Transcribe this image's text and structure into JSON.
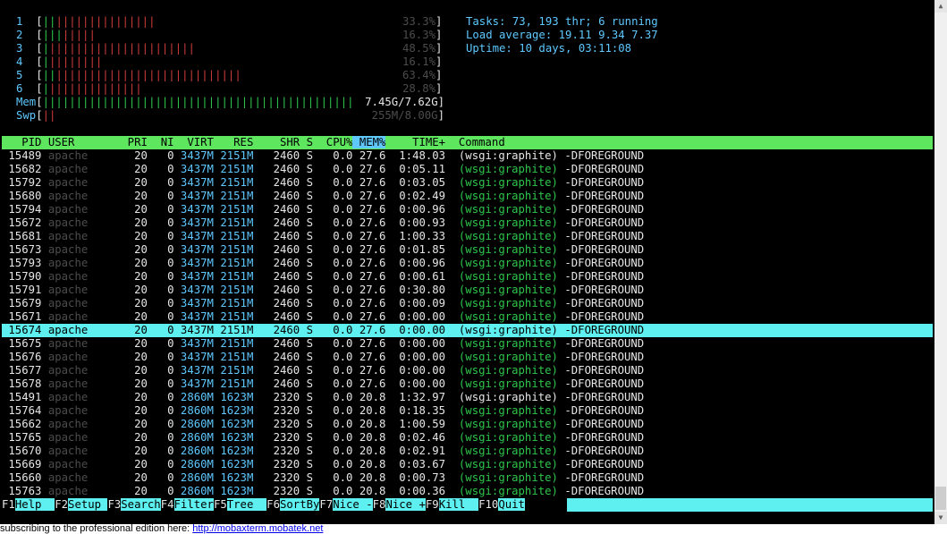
{
  "meters": {
    "cpus": [
      {
        "num": "1",
        "normal": "||",
        "kernel": "|||||||||||||||",
        "pct": "33.3%"
      },
      {
        "num": "2",
        "normal": "|||",
        "kernel": "|||||",
        "pct": "16.3%"
      },
      {
        "num": "3",
        "normal": "|",
        "kernel": "||||||||||||||||||||||",
        "pct": "48.5%"
      },
      {
        "num": "4",
        "normal": "|",
        "kernel": "||||||||",
        "pct": "16.1%"
      },
      {
        "num": "5",
        "normal": "||",
        "kernel": "||||||||||||||||||||||||||||",
        "pct": "63.4%"
      },
      {
        "num": "6",
        "normal": "|",
        "kernel": "||||||||||||||",
        "pct": "28.8%"
      }
    ],
    "mem": {
      "label": "Mem",
      "bars": "|||||||||||||||||||||||||||||||||||||||||||||||",
      "value": "7.45G/7.62G"
    },
    "swp": {
      "label": "Swp",
      "bars": "||",
      "value": "255M/8.00G"
    }
  },
  "summary": {
    "tasks": "Tasks: 73, 193 thr; 6 running",
    "load": "Load average: 19.11 9.34 7.37",
    "uptime": "Uptime: 10 days, 03:11:08"
  },
  "columns": [
    "PID",
    "USER",
    "PRI",
    "NI",
    "VIRT",
    "RES",
    "SHR",
    "S",
    "CPU%",
    "MEM%",
    "TIME+",
    "Command"
  ],
  "sorted_column": "MEM%",
  "processes": [
    {
      "pid": "15489",
      "user": "apache",
      "pri": "20",
      "ni": "0",
      "virt": "3437M",
      "res": "2151M",
      "shr": "2460",
      "s": "S",
      "cpu": "0.0",
      "mem": "27.6",
      "time": "1:48.03",
      "cmd": "(wsgi:graphite)",
      "args": "-DFOREGROUND",
      "main": true
    },
    {
      "pid": "15682",
      "user": "apache",
      "pri": "20",
      "ni": "0",
      "virt": "3437M",
      "res": "2151M",
      "shr": "2460",
      "s": "S",
      "cpu": "0.0",
      "mem": "27.6",
      "time": "0:05.11",
      "cmd": "(wsgi:graphite)",
      "args": "-DFOREGROUND",
      "main": false
    },
    {
      "pid": "15792",
      "user": "apache",
      "pri": "20",
      "ni": "0",
      "virt": "3437M",
      "res": "2151M",
      "shr": "2460",
      "s": "S",
      "cpu": "0.0",
      "mem": "27.6",
      "time": "0:03.05",
      "cmd": "(wsgi:graphite)",
      "args": "-DFOREGROUND",
      "main": false
    },
    {
      "pid": "15680",
      "user": "apache",
      "pri": "20",
      "ni": "0",
      "virt": "3437M",
      "res": "2151M",
      "shr": "2460",
      "s": "S",
      "cpu": "0.0",
      "mem": "27.6",
      "time": "0:02.49",
      "cmd": "(wsgi:graphite)",
      "args": "-DFOREGROUND",
      "main": false
    },
    {
      "pid": "15794",
      "user": "apache",
      "pri": "20",
      "ni": "0",
      "virt": "3437M",
      "res": "2151M",
      "shr": "2460",
      "s": "S",
      "cpu": "0.0",
      "mem": "27.6",
      "time": "0:00.96",
      "cmd": "(wsgi:graphite)",
      "args": "-DFOREGROUND",
      "main": false
    },
    {
      "pid": "15672",
      "user": "apache",
      "pri": "20",
      "ni": "0",
      "virt": "3437M",
      "res": "2151M",
      "shr": "2460",
      "s": "S",
      "cpu": "0.0",
      "mem": "27.6",
      "time": "0:00.93",
      "cmd": "(wsgi:graphite)",
      "args": "-DFOREGROUND",
      "main": false
    },
    {
      "pid": "15681",
      "user": "apache",
      "pri": "20",
      "ni": "0",
      "virt": "3437M",
      "res": "2151M",
      "shr": "2460",
      "s": "S",
      "cpu": "0.0",
      "mem": "27.6",
      "time": "1:00.33",
      "cmd": "(wsgi:graphite)",
      "args": "-DFOREGROUND",
      "main": false
    },
    {
      "pid": "15673",
      "user": "apache",
      "pri": "20",
      "ni": "0",
      "virt": "3437M",
      "res": "2151M",
      "shr": "2460",
      "s": "S",
      "cpu": "0.0",
      "mem": "27.6",
      "time": "0:01.85",
      "cmd": "(wsgi:graphite)",
      "args": "-DFOREGROUND",
      "main": false
    },
    {
      "pid": "15793",
      "user": "apache",
      "pri": "20",
      "ni": "0",
      "virt": "3437M",
      "res": "2151M",
      "shr": "2460",
      "s": "S",
      "cpu": "0.0",
      "mem": "27.6",
      "time": "0:00.96",
      "cmd": "(wsgi:graphite)",
      "args": "-DFOREGROUND",
      "main": false
    },
    {
      "pid": "15790",
      "user": "apache",
      "pri": "20",
      "ni": "0",
      "virt": "3437M",
      "res": "2151M",
      "shr": "2460",
      "s": "S",
      "cpu": "0.0",
      "mem": "27.6",
      "time": "0:00.61",
      "cmd": "(wsgi:graphite)",
      "args": "-DFOREGROUND",
      "main": false
    },
    {
      "pid": "15791",
      "user": "apache",
      "pri": "20",
      "ni": "0",
      "virt": "3437M",
      "res": "2151M",
      "shr": "2460",
      "s": "S",
      "cpu": "0.0",
      "mem": "27.6",
      "time": "0:30.80",
      "cmd": "(wsgi:graphite)",
      "args": "-DFOREGROUND",
      "main": false
    },
    {
      "pid": "15679",
      "user": "apache",
      "pri": "20",
      "ni": "0",
      "virt": "3437M",
      "res": "2151M",
      "shr": "2460",
      "s": "S",
      "cpu": "0.0",
      "mem": "27.6",
      "time": "0:00.09",
      "cmd": "(wsgi:graphite)",
      "args": "-DFOREGROUND",
      "main": false
    },
    {
      "pid": "15671",
      "user": "apache",
      "pri": "20",
      "ni": "0",
      "virt": "3437M",
      "res": "2151M",
      "shr": "2460",
      "s": "S",
      "cpu": "0.0",
      "mem": "27.6",
      "time": "0:00.00",
      "cmd": "(wsgi:graphite)",
      "args": "-DFOREGROUND",
      "main": false
    },
    {
      "pid": "15674",
      "user": "apache",
      "pri": "20",
      "ni": "0",
      "virt": "3437M",
      "res": "2151M",
      "shr": "2460",
      "s": "S",
      "cpu": "0.0",
      "mem": "27.6",
      "time": "0:00.00",
      "cmd": "(wsgi:graphite)",
      "args": "-DFOREGROUND",
      "main": false,
      "selected": true
    },
    {
      "pid": "15675",
      "user": "apache",
      "pri": "20",
      "ni": "0",
      "virt": "3437M",
      "res": "2151M",
      "shr": "2460",
      "s": "S",
      "cpu": "0.0",
      "mem": "27.6",
      "time": "0:00.00",
      "cmd": "(wsgi:graphite)",
      "args": "-DFOREGROUND",
      "main": false
    },
    {
      "pid": "15676",
      "user": "apache",
      "pri": "20",
      "ni": "0",
      "virt": "3437M",
      "res": "2151M",
      "shr": "2460",
      "s": "S",
      "cpu": "0.0",
      "mem": "27.6",
      "time": "0:00.00",
      "cmd": "(wsgi:graphite)",
      "args": "-DFOREGROUND",
      "main": false
    },
    {
      "pid": "15677",
      "user": "apache",
      "pri": "20",
      "ni": "0",
      "virt": "3437M",
      "res": "2151M",
      "shr": "2460",
      "s": "S",
      "cpu": "0.0",
      "mem": "27.6",
      "time": "0:00.00",
      "cmd": "(wsgi:graphite)",
      "args": "-DFOREGROUND",
      "main": false
    },
    {
      "pid": "15678",
      "user": "apache",
      "pri": "20",
      "ni": "0",
      "virt": "3437M",
      "res": "2151M",
      "shr": "2460",
      "s": "S",
      "cpu": "0.0",
      "mem": "27.6",
      "time": "0:00.00",
      "cmd": "(wsgi:graphite)",
      "args": "-DFOREGROUND",
      "main": false
    },
    {
      "pid": "15491",
      "user": "apache",
      "pri": "20",
      "ni": "0",
      "virt": "2860M",
      "res": "1623M",
      "shr": "2320",
      "s": "S",
      "cpu": "0.0",
      "mem": "20.8",
      "time": "1:32.97",
      "cmd": "(wsgi:graphite)",
      "args": "-DFOREGROUND",
      "main": true
    },
    {
      "pid": "15764",
      "user": "apache",
      "pri": "20",
      "ni": "0",
      "virt": "2860M",
      "res": "1623M",
      "shr": "2320",
      "s": "S",
      "cpu": "0.0",
      "mem": "20.8",
      "time": "0:18.35",
      "cmd": "(wsgi:graphite)",
      "args": "-DFOREGROUND",
      "main": false
    },
    {
      "pid": "15662",
      "user": "apache",
      "pri": "20",
      "ni": "0",
      "virt": "2860M",
      "res": "1623M",
      "shr": "2320",
      "s": "S",
      "cpu": "0.0",
      "mem": "20.8",
      "time": "1:00.59",
      "cmd": "(wsgi:graphite)",
      "args": "-DFOREGROUND",
      "main": false
    },
    {
      "pid": "15765",
      "user": "apache",
      "pri": "20",
      "ni": "0",
      "virt": "2860M",
      "res": "1623M",
      "shr": "2320",
      "s": "S",
      "cpu": "0.0",
      "mem": "20.8",
      "time": "0:02.46",
      "cmd": "(wsgi:graphite)",
      "args": "-DFOREGROUND",
      "main": false
    },
    {
      "pid": "15670",
      "user": "apache",
      "pri": "20",
      "ni": "0",
      "virt": "2860M",
      "res": "1623M",
      "shr": "2320",
      "s": "S",
      "cpu": "0.0",
      "mem": "20.8",
      "time": "0:02.91",
      "cmd": "(wsgi:graphite)",
      "args": "-DFOREGROUND",
      "main": false
    },
    {
      "pid": "15669",
      "user": "apache",
      "pri": "20",
      "ni": "0",
      "virt": "2860M",
      "res": "1623M",
      "shr": "2320",
      "s": "S",
      "cpu": "0.0",
      "mem": "20.8",
      "time": "0:03.67",
      "cmd": "(wsgi:graphite)",
      "args": "-DFOREGROUND",
      "main": false
    },
    {
      "pid": "15660",
      "user": "apache",
      "pri": "20",
      "ni": "0",
      "virt": "2860M",
      "res": "1623M",
      "shr": "2320",
      "s": "S",
      "cpu": "0.0",
      "mem": "20.8",
      "time": "0:00.73",
      "cmd": "(wsgi:graphite)",
      "args": "-DFOREGROUND",
      "main": false
    },
    {
      "pid": "15763",
      "user": "apache",
      "pri": "20",
      "ni": "0",
      "virt": "2860M",
      "res": "1623M",
      "shr": "2320",
      "s": "S",
      "cpu": "0.0",
      "mem": "20.8",
      "time": "0:00.36",
      "cmd": "(wsgi:graphite)",
      "args": "-DFOREGROUND",
      "main": false
    }
  ],
  "function_keys": [
    {
      "key": "F1",
      "label": "Help  "
    },
    {
      "key": "F2",
      "label": "Setup "
    },
    {
      "key": "F3",
      "label": "Search"
    },
    {
      "key": "F4",
      "label": "Filter"
    },
    {
      "key": "F5",
      "label": "Tree  "
    },
    {
      "key": "F6",
      "label": "SortBy"
    },
    {
      "key": "F7",
      "label": "Nice -"
    },
    {
      "key": "F8",
      "label": "Nice +"
    },
    {
      "key": "F9",
      "label": "Kill  "
    },
    {
      "key": "F10",
      "label": "Quit"
    }
  ],
  "footer": {
    "text": "subscribing to the professional edition here: ",
    "link": "http://mobaxterm.mobatek.net"
  },
  "colors": {
    "background": "#000000",
    "header_bar": "#5ee65e",
    "selection": "#5ef0f0",
    "cpu_normal": "#2ec54b",
    "cpu_kernel": "#cc3b3b",
    "accent_cyan": "#5ec8ff"
  }
}
